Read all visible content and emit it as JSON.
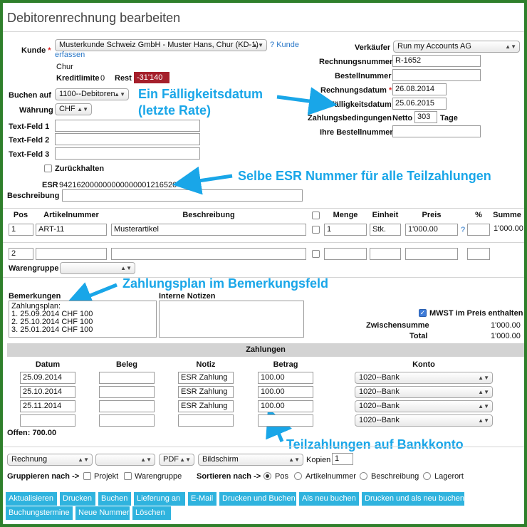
{
  "page_title": "Debitorenrechnung bearbeiten",
  "kunde": {
    "label": "Kunde",
    "required": "*",
    "value": "Musterkunde Schweiz GmbH - Muster Hans, Chur (KD-1)",
    "link_q": "?",
    "link_text_1": "Kunde",
    "link_text_2": "erfassen",
    "city": "Chur",
    "kreditlimite_label": "Kreditlimite",
    "kreditlimite_value": "0",
    "rest_label": "Rest",
    "rest_value": "-31'140"
  },
  "buchen_auf": {
    "label": "Buchen auf",
    "value": "1100--Debitoren"
  },
  "waehrung": {
    "label": "Währung",
    "value": "CHF"
  },
  "textfeld1": {
    "label": "Text-Feld 1",
    "value": ""
  },
  "textfeld2": {
    "label": "Text-Feld 2",
    "value": ""
  },
  "textfeld3": {
    "label": "Text-Feld 3",
    "value": ""
  },
  "zurueckhalten": {
    "label": "Zurückhalten"
  },
  "esr": {
    "label": "ESR",
    "value": "942162000000000000001216526"
  },
  "beschreibung": {
    "label": "Beschreibung",
    "value": ""
  },
  "right_panel": {
    "verkaeufer_label": "Verkäufer",
    "verkaeufer_value": "Run my Accounts AG",
    "rechnungsnummer_label": "Rechnungsnummer",
    "rechnungsnummer_value": "R-1652",
    "bestellnummer_label": "Bestellnummer",
    "bestellnummer_value": "",
    "rechnungsdatum_label": "Rechnungsdatum",
    "rechnungsdatum_required": "*",
    "rechnungsdatum_value": "26.08.2014",
    "faelligkeitsdatum_label": "Fälligkeitsdatum",
    "faelligkeitsdatum_value": "25.06.2015",
    "zahlungsbedingungen_label": "Zahlungsbedingungen",
    "netto_label": "Netto",
    "netto_value": "303",
    "tage_label": "Tage",
    "ihre_bestellnummer_label": "Ihre Bestellnummer",
    "ihre_bestellnummer_value": ""
  },
  "items_table": {
    "headers": {
      "pos": "Pos",
      "artikelnummer": "Artikelnummer",
      "beschreibung": "Beschreibung",
      "menge": "Menge",
      "einheit": "Einheit",
      "preis": "Preis",
      "percent": "%",
      "summe": "Summe"
    },
    "row1": {
      "pos": "1",
      "artikelnummer": "ART-11",
      "beschreibung": "Musterartikel",
      "menge": "1",
      "einheit": "Stk.",
      "preis": "1'000.00",
      "help": "?",
      "summe": "1'000.00"
    },
    "row2": {
      "pos": "2"
    },
    "warengruppe_label": "Warengruppe",
    "warengruppe_value": ""
  },
  "bemerkungen": {
    "label": "Bemerkungen",
    "value": "Zahlungsplan:\n1. 25.09.2014 CHF 100\n2. 25.10.2014 CHF 100\n3. 25.01.2014 CHF 100"
  },
  "interne_notizen": {
    "label": "Interne Notizen",
    "value": ""
  },
  "totals": {
    "mwst_label": "MWST im Preis enthalten",
    "zwischensumme_label": "Zwischensumme",
    "zwischensumme_value": "1'000.00",
    "total_label": "Total",
    "total_value": "1'000.00"
  },
  "zahlungen": {
    "title": "Zahlungen",
    "headers": {
      "datum": "Datum",
      "beleg": "Beleg",
      "notiz": "Notiz",
      "betrag": "Betrag",
      "konto": "Konto"
    },
    "rows": [
      {
        "datum": "25.09.2014",
        "beleg": "",
        "notiz": "ESR Zahlung",
        "betrag": "100.00",
        "konto": "1020--Bank"
      },
      {
        "datum": "25.10.2014",
        "beleg": "",
        "notiz": "ESR Zahlung",
        "betrag": "100.00",
        "konto": "1020--Bank"
      },
      {
        "datum": "25.11.2014",
        "beleg": "",
        "notiz": "ESR Zahlung",
        "betrag": "100.00",
        "konto": "1020--Bank"
      },
      {
        "datum": "",
        "beleg": "",
        "notiz": "",
        "betrag": "",
        "konto": "1020--Bank"
      }
    ],
    "offen": "Offen: 700.00"
  },
  "print": {
    "format_value": "Rechnung",
    "second_value": "",
    "type_value": "PDF",
    "target_value": "Bildschirm",
    "kopien_label": "Kopien",
    "kopien_value": "1"
  },
  "gruppieren": {
    "label": "Gruppieren nach ->",
    "projekt": "Projekt",
    "warengruppe": "Warengruppe"
  },
  "sortieren": {
    "label": "Sortieren nach ->",
    "pos": "Pos",
    "artikelnummer": "Artikelnummer",
    "beschreibung": "Beschreibung",
    "lagerort": "Lagerort"
  },
  "buttons": {
    "aktualisieren": "Aktualisieren",
    "drucken": "Drucken",
    "buchen": "Buchen",
    "lieferung_an": "Lieferung an",
    "email": "E-Mail",
    "drucken_und_buchen": "Drucken und Buchen",
    "als_neu_buchen": "Als neu buchen",
    "drucken_und_als_neu_buchen": "Drucken und als neu buchen",
    "buchungstermine": "Buchungstermine",
    "neue_nummer": "Neue Nummer",
    "loeschen": "Löschen"
  },
  "annotations": {
    "faelligkeit_line1": "Ein Fälligkeitsdatum",
    "faelligkeit_line2": "(letzte Rate)",
    "esr_note": "Selbe ESR Nummer für alle Teilzahlungen",
    "zahlungsplan_note": "Zahlungsplan im Bemerkungsfeld",
    "teilzahlungen_note": "Teilzahlungen auf Bankkonto"
  },
  "colors": {
    "annotation": "#19a6e8",
    "button": "#2fb3de",
    "rest_badge": "#a51f2b",
    "frame": "#2f7f2b"
  }
}
